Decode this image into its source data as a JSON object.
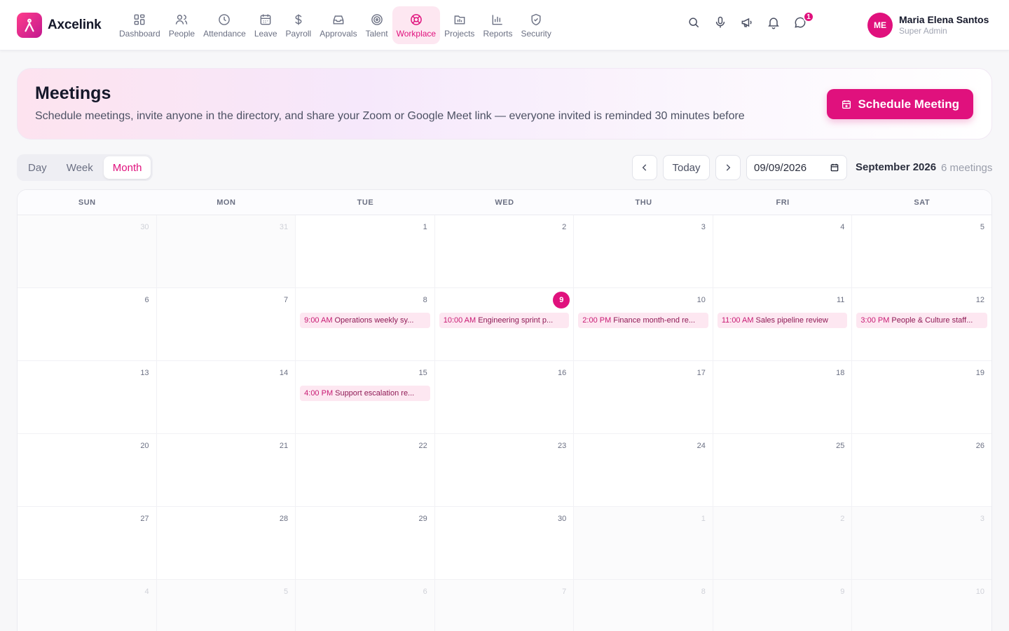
{
  "app": {
    "name": "Axcelink"
  },
  "nav": [
    {
      "label": "Dashboard",
      "icon": "dashboard-icon"
    },
    {
      "label": "People",
      "icon": "people-icon"
    },
    {
      "label": "Attendance",
      "icon": "clock-icon"
    },
    {
      "label": "Leave",
      "icon": "calendar-icon"
    },
    {
      "label": "Payroll",
      "icon": "dollar-icon"
    },
    {
      "label": "Approvals",
      "icon": "inbox-icon"
    },
    {
      "label": "Talent",
      "icon": "target-icon"
    },
    {
      "label": "Workplace",
      "icon": "lifebuoy-icon",
      "active": true
    },
    {
      "label": "Projects",
      "icon": "folder-icon"
    },
    {
      "label": "Reports",
      "icon": "bar-chart-icon"
    },
    {
      "label": "Security",
      "icon": "shield-icon"
    }
  ],
  "header_actions": {
    "notification_count": "1"
  },
  "user": {
    "initials": "ME",
    "name": "Maria Elena Santos",
    "role": "Super Admin"
  },
  "page": {
    "title": "Meetings",
    "subtitle": "Schedule meetings, invite anyone in the directory, and share your Zoom or Google Meet link — everyone invited is reminded 30 minutes before",
    "primary_button": "Schedule Meeting"
  },
  "controls": {
    "views": [
      "Day",
      "Week",
      "Month"
    ],
    "active_view": "Month",
    "today_label": "Today",
    "date_value": "09/09/2026",
    "period_label": "September 2026",
    "meeting_count": "6 meetings"
  },
  "calendar": {
    "weekdays": [
      "SUN",
      "MON",
      "TUE",
      "WED",
      "THU",
      "FRI",
      "SAT"
    ],
    "today": "9",
    "days": [
      {
        "n": "30",
        "out": true
      },
      {
        "n": "31",
        "out": true
      },
      {
        "n": "1"
      },
      {
        "n": "2"
      },
      {
        "n": "3"
      },
      {
        "n": "4"
      },
      {
        "n": "5"
      },
      {
        "n": "6"
      },
      {
        "n": "7"
      },
      {
        "n": "8",
        "event": {
          "time": "9:00 AM",
          "title": "Operations weekly sy..."
        }
      },
      {
        "n": "9",
        "today": true,
        "event": {
          "time": "10:00 AM",
          "title": "Engineering sprint p..."
        }
      },
      {
        "n": "10",
        "event": {
          "time": "2:00 PM",
          "title": "Finance month-end re..."
        }
      },
      {
        "n": "11",
        "event": {
          "time": "11:00 AM",
          "title": "Sales pipeline review"
        }
      },
      {
        "n": "12",
        "event": {
          "time": "3:00 PM",
          "title": "People & Culture staff..."
        }
      },
      {
        "n": "13"
      },
      {
        "n": "14"
      },
      {
        "n": "15",
        "event": {
          "time": "4:00 PM",
          "title": "Support escalation re..."
        }
      },
      {
        "n": "16"
      },
      {
        "n": "17"
      },
      {
        "n": "18"
      },
      {
        "n": "19"
      },
      {
        "n": "20"
      },
      {
        "n": "21"
      },
      {
        "n": "22"
      },
      {
        "n": "23"
      },
      {
        "n": "24"
      },
      {
        "n": "25"
      },
      {
        "n": "26"
      },
      {
        "n": "27"
      },
      {
        "n": "28"
      },
      {
        "n": "29"
      },
      {
        "n": "30"
      },
      {
        "n": "1",
        "out": true
      },
      {
        "n": "2",
        "out": true
      },
      {
        "n": "3",
        "out": true
      },
      {
        "n": "4",
        "out": true
      },
      {
        "n": "5",
        "out": true
      },
      {
        "n": "6",
        "out": true
      },
      {
        "n": "7",
        "out": true
      },
      {
        "n": "8",
        "out": true
      },
      {
        "n": "9",
        "out": true
      },
      {
        "n": "10",
        "out": true
      }
    ]
  },
  "colors": {
    "accent": "#e0117d",
    "accent_soft": "#fde7f1"
  }
}
